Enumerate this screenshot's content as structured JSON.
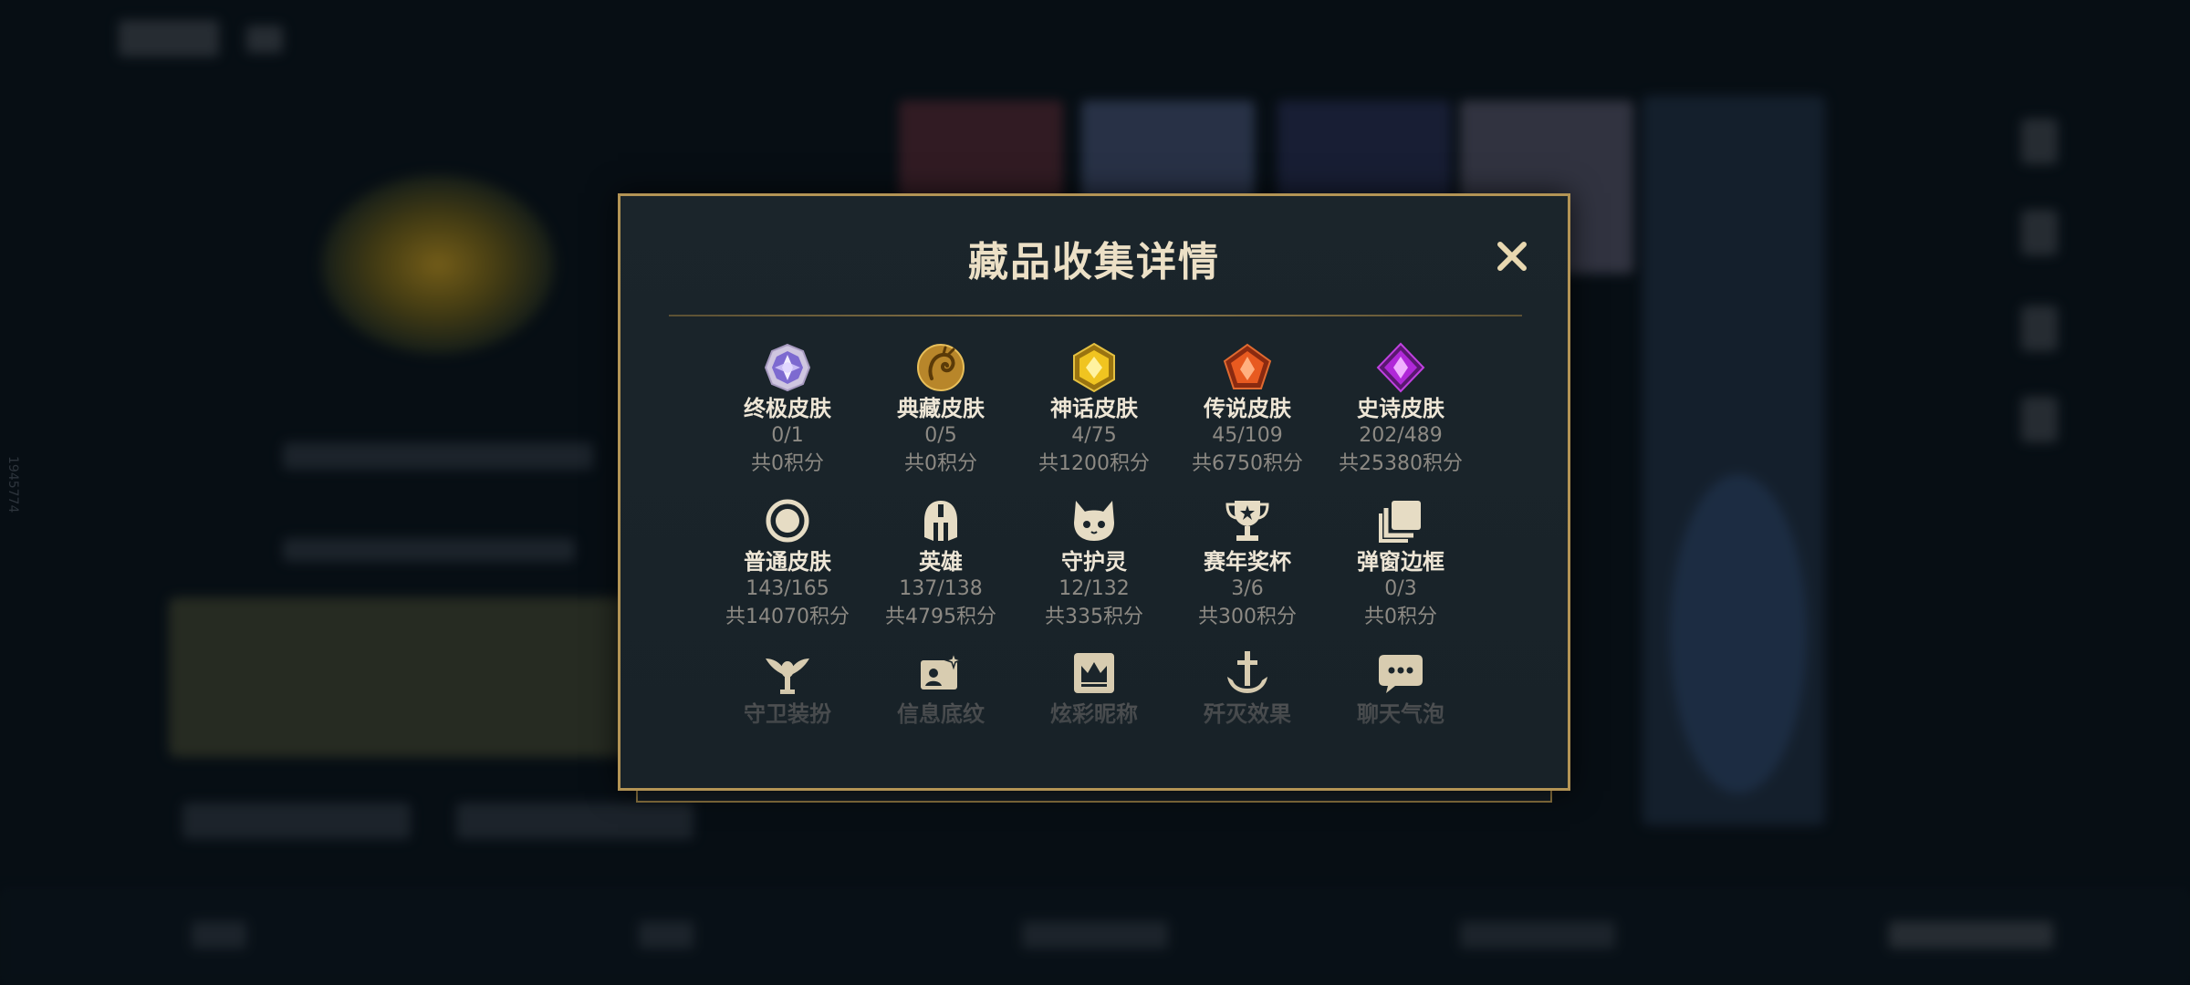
{
  "background": {
    "side_id": "1945774"
  },
  "modal": {
    "title": "藏品收集详情",
    "close_label": "✕",
    "items": [
      {
        "name": "终极皮肤",
        "count": "0/1",
        "points": "共0积分",
        "icon": "ultimate-gem-icon"
      },
      {
        "name": "典藏皮肤",
        "count": "0/5",
        "points": "共0积分",
        "icon": "dragon-coin-icon"
      },
      {
        "name": "神话皮肤",
        "count": "4/75",
        "points": "共1200积分",
        "icon": "mythic-gem-icon"
      },
      {
        "name": "传说皮肤",
        "count": "45/109",
        "points": "共6750积分",
        "icon": "legendary-gem-icon"
      },
      {
        "name": "史诗皮肤",
        "count": "202/489",
        "points": "共25380积分",
        "icon": "epic-gem-icon"
      },
      {
        "name": "普通皮肤",
        "count": "143/165",
        "points": "共14070积分",
        "icon": "circle-icon"
      },
      {
        "name": "英雄",
        "count": "137/138",
        "points": "共4795积分",
        "icon": "helmet-icon"
      },
      {
        "name": "守护灵",
        "count": "12/132",
        "points": "共335积分",
        "icon": "guardian-face-icon"
      },
      {
        "name": "赛年奖杯",
        "count": "3/6",
        "points": "共300积分",
        "icon": "trophy-icon"
      },
      {
        "name": "弹窗边框",
        "count": "0/3",
        "points": "共0积分",
        "icon": "frame-stack-icon"
      },
      {
        "name": "守卫装扮",
        "icon": "winged-ward-icon"
      },
      {
        "name": "信息底纹",
        "icon": "card-sparkle-icon"
      },
      {
        "name": "炫彩昵称",
        "icon": "crown-card-icon"
      },
      {
        "name": "歼灭效果",
        "icon": "anchor-sword-icon"
      },
      {
        "name": "聊天气泡",
        "icon": "chat-bubble-icon"
      }
    ]
  },
  "colors": {
    "gold_border": "#b39455",
    "panel_bg": "#1b252b",
    "title": "#ece0c6",
    "label": "#eee6d6",
    "muted": "#8d8a84"
  }
}
